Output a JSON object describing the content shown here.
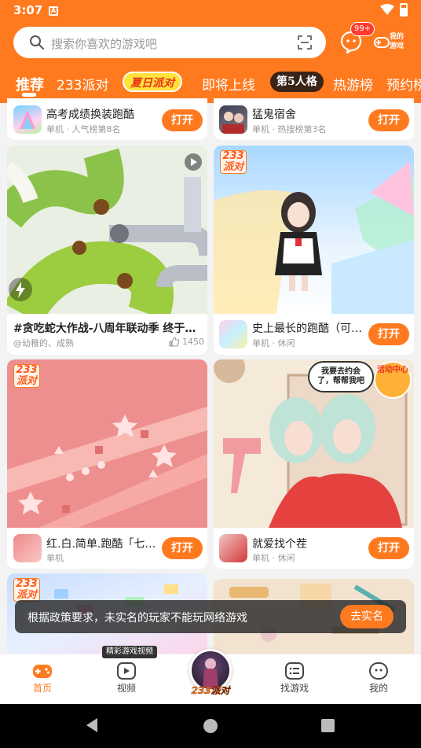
{
  "status": {
    "time": "3:07",
    "notif_glyph": "A"
  },
  "search": {
    "placeholder": "搜索你喜欢的游戏吧"
  },
  "header": {
    "msg_badge": "99+",
    "mygame_label": "我的游戏"
  },
  "tabs": [
    {
      "label": "推荐",
      "active": true
    },
    {
      "label": "233派对"
    },
    {
      "label": "夏日派对"
    },
    {
      "label": "即将上线"
    },
    {
      "label": "第5人格"
    },
    {
      "label": "热游榜"
    },
    {
      "label": "预约榜"
    }
  ],
  "feed": {
    "open_label": "打开",
    "row_top": [
      {
        "name": "高考成绩换装跑酷",
        "meta": "单机 · 人气榜第8名"
      },
      {
        "name": "猛鬼宿舍",
        "meta": "单机 · 热搜榜第3名"
      }
    ],
    "video_card": {
      "title": "#贪吃蛇大作战-八周年联动季 终于翻身…",
      "author": "@幼稚的、成熟",
      "likes": "1450"
    },
    "game_card_1": {
      "name": "史上最长的跑酷（可飞…",
      "meta": "单机 · 休闲",
      "badge": "233派对"
    },
    "game_card_2": {
      "name": "红.白.简单.跑酷「七夕…",
      "meta": "单机",
      "badge": "233派对"
    },
    "game_card_3": {
      "name": "就爱找个茬",
      "meta": "单机 · 休闲",
      "speech": "我要去约会了，帮帮我吧",
      "event_badge": "活动中心"
    },
    "game_card_4": {
      "badge": "233派对"
    }
  },
  "toast": {
    "text": "根据政策要求，未实名的玩家不能玩网络游戏",
    "button": "去实名"
  },
  "bottom_nav": {
    "video_tip": "精彩游戏视频",
    "items": [
      {
        "label": "首页",
        "icon": "gamepad-icon",
        "active": true
      },
      {
        "label": "视频",
        "icon": "video-icon"
      },
      {
        "label": "233派对",
        "icon": "party-avatar"
      },
      {
        "label": "找游戏",
        "icon": "list-icon"
      },
      {
        "label": "我的",
        "icon": "profile-icon"
      }
    ]
  },
  "colors": {
    "brand": "#ff7a1f",
    "text": "#222222",
    "meta": "#999999"
  }
}
